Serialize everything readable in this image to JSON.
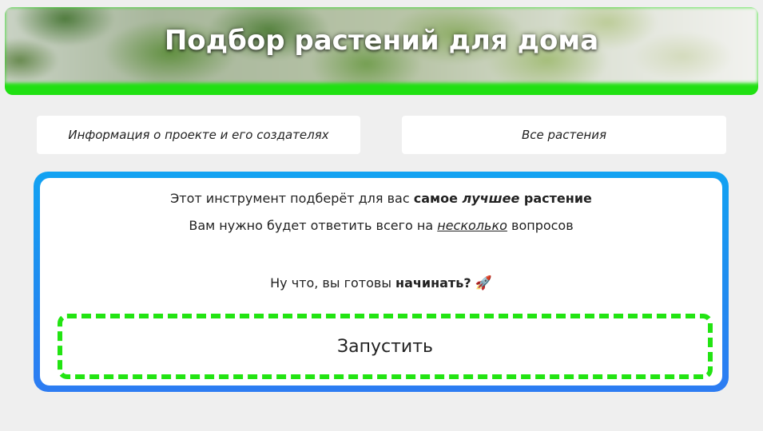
{
  "header": {
    "title": "Подбор растений для дома"
  },
  "nav": {
    "about_label": "Информация о проекте и его создателях",
    "all_plants_label": "Все растения"
  },
  "intro": {
    "line1_prefix": "Этот инструмент подберёт для вас ",
    "line1_bold1": "самое ",
    "line1_bold_italic": "лучшее",
    "line1_bold2": " растение",
    "line2_prefix": "Вам нужно будет ответить всего на ",
    "line2_emphasis": "несколько",
    "line2_suffix": " вопросов",
    "line3_prefix": "Ну что, вы готовы ",
    "line3_bold": "начинать?",
    "line3_emoji": "🚀"
  },
  "start_button": {
    "label": "Запустить"
  },
  "colors": {
    "accent_green": "#22e412",
    "card_blue": "#1f8df0",
    "background": "#efefef"
  }
}
